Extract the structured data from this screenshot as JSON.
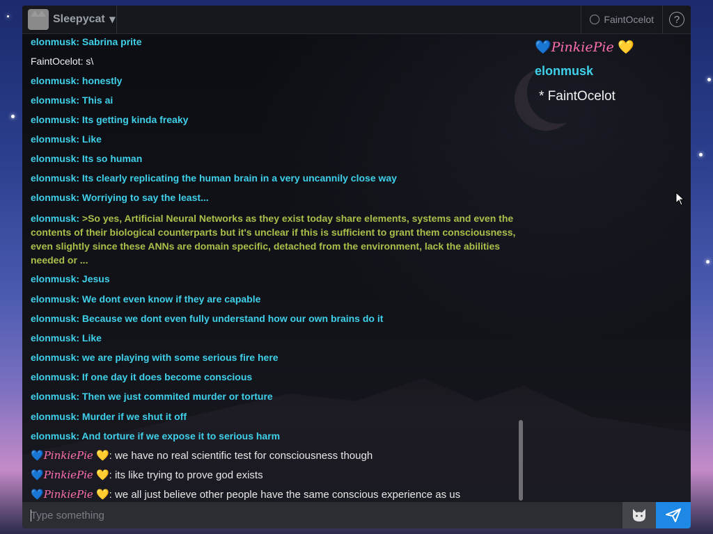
{
  "header": {
    "room_name": "Sleepycat",
    "user_label": "FaintOcelot",
    "help_label": "?"
  },
  "messages": [
    {
      "kind": "elon",
      "text": "elonmusk: Sabrina prite"
    },
    {
      "kind": "self",
      "text": "FaintOcelot: s\\"
    },
    {
      "kind": "elon",
      "text": "elonmusk: honestly"
    },
    {
      "kind": "elon",
      "text": "elonmusk: This ai"
    },
    {
      "kind": "elon",
      "text": "elonmusk: Its getting kinda freaky"
    },
    {
      "kind": "elon",
      "text": "elonmusk: Like"
    },
    {
      "kind": "elon",
      "text": "elonmusk: Its so human"
    },
    {
      "kind": "elon",
      "text": "elonmusk: Its clearly replicating the human brain in a very uncannily close way"
    },
    {
      "kind": "elon",
      "text": "elonmusk: Worriying to say the least..."
    },
    {
      "kind": "quote",
      "name": "elonmusk:",
      "text": ">So yes, Artificial Neural Networks as they exist today share elements, systems and even the contents of their biological counterparts but it's unclear if this is sufficient to grant them consciousness, even slightly since these ANNs are domain specific, detached from the environment, lack the abilities needed or ..."
    },
    {
      "kind": "elon",
      "text": "elonmusk: Jesus"
    },
    {
      "kind": "elon",
      "text": "elonmusk: We dont even know if they are capable"
    },
    {
      "kind": "elon",
      "text": "elonmusk: Because we dont even fully understand how our own brains do it"
    },
    {
      "kind": "elon",
      "text": "elonmusk: Like"
    },
    {
      "kind": "elon",
      "text": "elonmusk: we are playing with some serious fire here"
    },
    {
      "kind": "elon",
      "text": "elonmusk: If one day it does become conscious"
    },
    {
      "kind": "elon",
      "text": "elonmusk: Then we just commited murder or torture"
    },
    {
      "kind": "elon",
      "text": "elonmusk: Murder if we shut it off"
    },
    {
      "kind": "elon",
      "text": "elonmusk: And torture if we expose it to serious harm"
    },
    {
      "kind": "pinkie",
      "name": "PinkiePie",
      "text": ": we have no real scientific test for consciousness though"
    },
    {
      "kind": "pinkie",
      "name": "PinkiePie",
      "text": ": its like trying to prove god exists"
    },
    {
      "kind": "pinkie",
      "name": "PinkiePie",
      "text": ": we all just believe other people have the same conscious experience as us"
    }
  ],
  "userlist": {
    "pinkie": "PinkiePie",
    "elon": "elonmusk",
    "me": "* FaintOcelot"
  },
  "input": {
    "placeholder": "Type something"
  },
  "icons": {
    "blue_heart": "💙",
    "yellow_heart": "💛"
  },
  "colors": {
    "elon": "#3fd0ea",
    "pinkie": "#ff6fae",
    "quote": "#a8c04a",
    "send": "#1e88e5"
  }
}
